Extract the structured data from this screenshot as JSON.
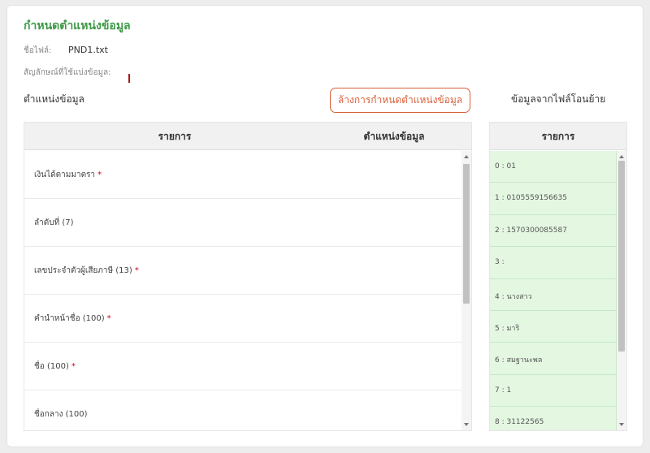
{
  "title": "กำหนดตำแหน่งข้อมูล",
  "file": {
    "label": "ชื่อไฟล์:",
    "value": "PND1.txt"
  },
  "delimiter": {
    "label": "สัญลักษณ์ที่ใช้แบ่งข้อมูล:"
  },
  "position_section_label": "ตำแหน่งข้อมูล",
  "clear_button_label": "ล้างการกำหนดตำแหน่งข้อมูล",
  "transfer_section_label": "ข้อมูลจากไฟล์โอนย้าย",
  "left_table": {
    "headers": {
      "item": "รายการ",
      "position": "ตำแหน่งข้อมูล"
    },
    "rows": [
      {
        "label": "เงินได้ตามมาตรา",
        "required": "*"
      },
      {
        "label": "ลำดับที่ (7)",
        "required": ""
      },
      {
        "label": "เลขประจำตัวผู้เสียภาษี (13)",
        "required": "*"
      },
      {
        "label": "คำนำหน้าชื่อ (100)",
        "required": "*"
      },
      {
        "label": "ชื่อ (100)",
        "required": "*"
      },
      {
        "label": "ชื่อกลาง (100)",
        "required": ""
      }
    ]
  },
  "right_table": {
    "header": "รายการ",
    "rows": [
      "0 : 01",
      "1 : 0105559156635",
      "2 : 1570300085587",
      "3 :",
      "4 : นางสาว",
      "5 : มาริ",
      "6 : สมฐานะพล",
      "7 : 1",
      "8 : 31122565"
    ]
  }
}
